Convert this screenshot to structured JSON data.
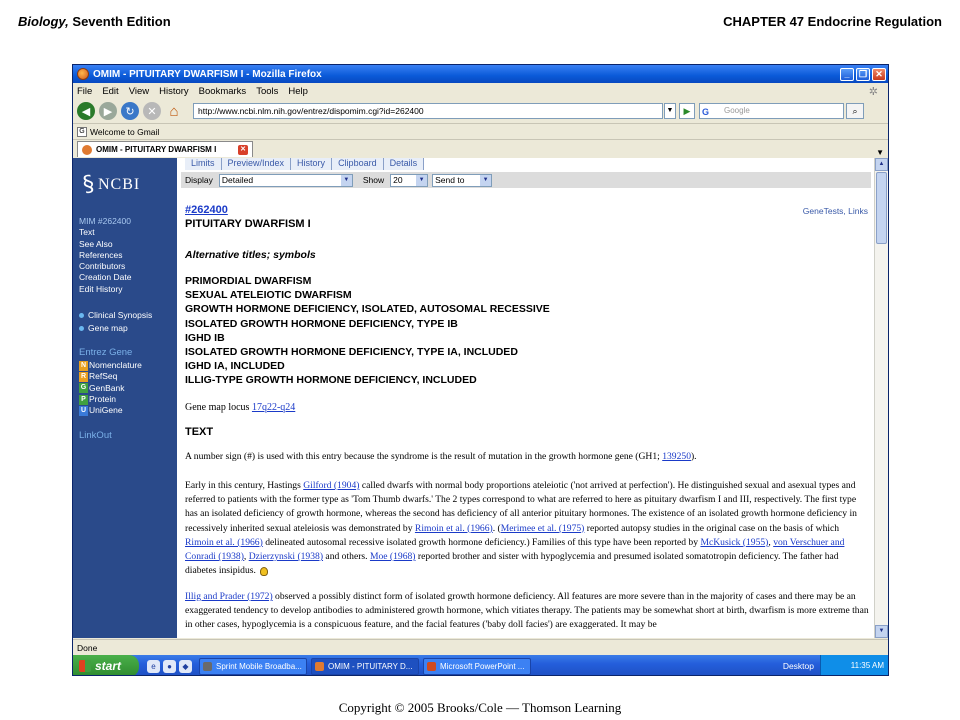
{
  "slide": {
    "book_title_italic": "Biology,",
    "book_title_rest": " Seventh Edition",
    "chapter": "CHAPTER 47 Endocrine Regulation",
    "copyright": "Copyright © 2005 Brooks/Cole — Thomson Learning"
  },
  "window": {
    "title": "OMIM - PITUITARY DWARFISM I - Mozilla Firefox",
    "menu": [
      "File",
      "Edit",
      "View",
      "History",
      "Bookmarks",
      "Tools",
      "Help"
    ],
    "url": "http://www.ncbi.nlm.nih.gov/entrez/dispomim.cgi?id=262400",
    "search_placeholder": "Google",
    "bookmark": "Welcome to Gmail",
    "tab_title": "OMIM - PITUITARY DWARFISM I",
    "status": "Done"
  },
  "sidebar": {
    "logo": "NCBI",
    "mim_number": "MIM #262400",
    "links": [
      "Text",
      "See Also",
      "References",
      "Contributors",
      "Creation Date",
      "Edit History"
    ],
    "bullets": [
      "Clinical Synopsis",
      "Gene map"
    ],
    "entrez_heading": "Entrez Gene",
    "entrez_items": [
      {
        "letter": "N",
        "label": "Nomenclature",
        "color": "#e8a020"
      },
      {
        "letter": "R",
        "label": "RefSeq",
        "color": "#e8a020"
      },
      {
        "letter": "G",
        "label": "GenBank",
        "color": "#40a040"
      },
      {
        "letter": "P",
        "label": "Protein",
        "color": "#40a040"
      },
      {
        "letter": "U",
        "label": "UniGene",
        "color": "#3a7ad8"
      }
    ],
    "linkout": "LinkOut"
  },
  "toolbar": {
    "tabs": [
      "Limits",
      "Preview/Index",
      "History",
      "Clipboard",
      "Details"
    ],
    "display_label": "Display",
    "display_value": "Detailed",
    "show_label": "Show",
    "show_value": "20",
    "send_value": "Send to"
  },
  "entry": {
    "number": "#262400",
    "title": "PITUITARY DWARFISM I",
    "side_links": "GeneTests, Links",
    "alt_heading": "Alternative titles; symbols",
    "alt_titles": [
      "PRIMORDIAL DWARFISM",
      "SEXUAL ATELEIOTIC DWARFISM",
      "GROWTH HORMONE DEFICIENCY, ISOLATED, AUTOSOMAL RECESSIVE",
      "ISOLATED GROWTH HORMONE DEFICIENCY, TYPE IB",
      "IGHD IB",
      "ISOLATED GROWTH HORMONE DEFICIENCY, TYPE IA, INCLUDED",
      "IGHD IA, INCLUDED",
      "ILLIG-TYPE GROWTH HORMONE DEFICIENCY, INCLUDED"
    ],
    "locus_label": "Gene map locus ",
    "locus_link": "17q22-q24",
    "text_heading": "TEXT",
    "p1_before": "A number sign (#) is used with this entry because the syndrome is the result of mutation in the growth hormone gene (GH1; ",
    "p1_link": "139250",
    "p1_after": ").",
    "p2": {
      "t1": "Early in this century, Hastings ",
      "l1": "Gilford (1904)",
      "t2": " called dwarfs with normal body proportions ateleiotic ('not arrived at perfection'). He distinguished sexual and asexual types and referred to patients with the former type as 'Tom Thumb dwarfs.' The 2 types correspond to what are referred to here as pituitary dwarfism I and III, respectively. The first type has an isolated deficiency of growth hormone, whereas the second has deficiency of all anterior pituitary hormones. The existence of an isolated growth hormone deficiency in recessively inherited sexual ateleiosis was demonstrated by ",
      "l2": "Rimoin et al. (1966)",
      "t3": ". (",
      "l3": "Merimee et al. (1975)",
      "t4": " reported autopsy studies in the original case on the basis of which ",
      "l4": "Rimoin et al. (1966)",
      "t5": " delineated autosomal recessive isolated growth hormone deficiency.) Families of this type have been reported by ",
      "l5": "McKusick (1955)",
      "t6": ", ",
      "l6": "von Verschuer and Conradi (1938)",
      "t7": ", ",
      "l7": "Dzierzynski (1938)",
      "t8": " and others. ",
      "l8": "Moe (1968)",
      "t9": " reported brother and sister with hypoglycemia and presumed isolated somatotropin deficiency. The father had diabetes insipidus."
    },
    "p3": {
      "l1": "Illig and Prader (1972)",
      "t1": " observed a possibly distinct form of isolated growth hormone deficiency. All features are more severe than in the majority of cases and there may be an exaggerated tendency to develop antibodies to administered growth hormone, which vitiates therapy. The patients may be somewhat short at birth, dwarfism is more extreme than in other cases, hypoglycemia is a conspicuous feature, and the facial features ('baby doll facies') are exaggerated. It may be"
    }
  },
  "taskbar": {
    "start": "start",
    "tasks": [
      {
        "label": "Sprint Mobile Broadba...",
        "color": "#6a6a6a"
      },
      {
        "label": "OMIM - PITUITARY D...",
        "color": "#e07a30"
      },
      {
        "label": "Microsoft PowerPoint ...",
        "color": "#d04a20"
      }
    ],
    "desktop": "Desktop",
    "clock": "11:35 AM"
  }
}
